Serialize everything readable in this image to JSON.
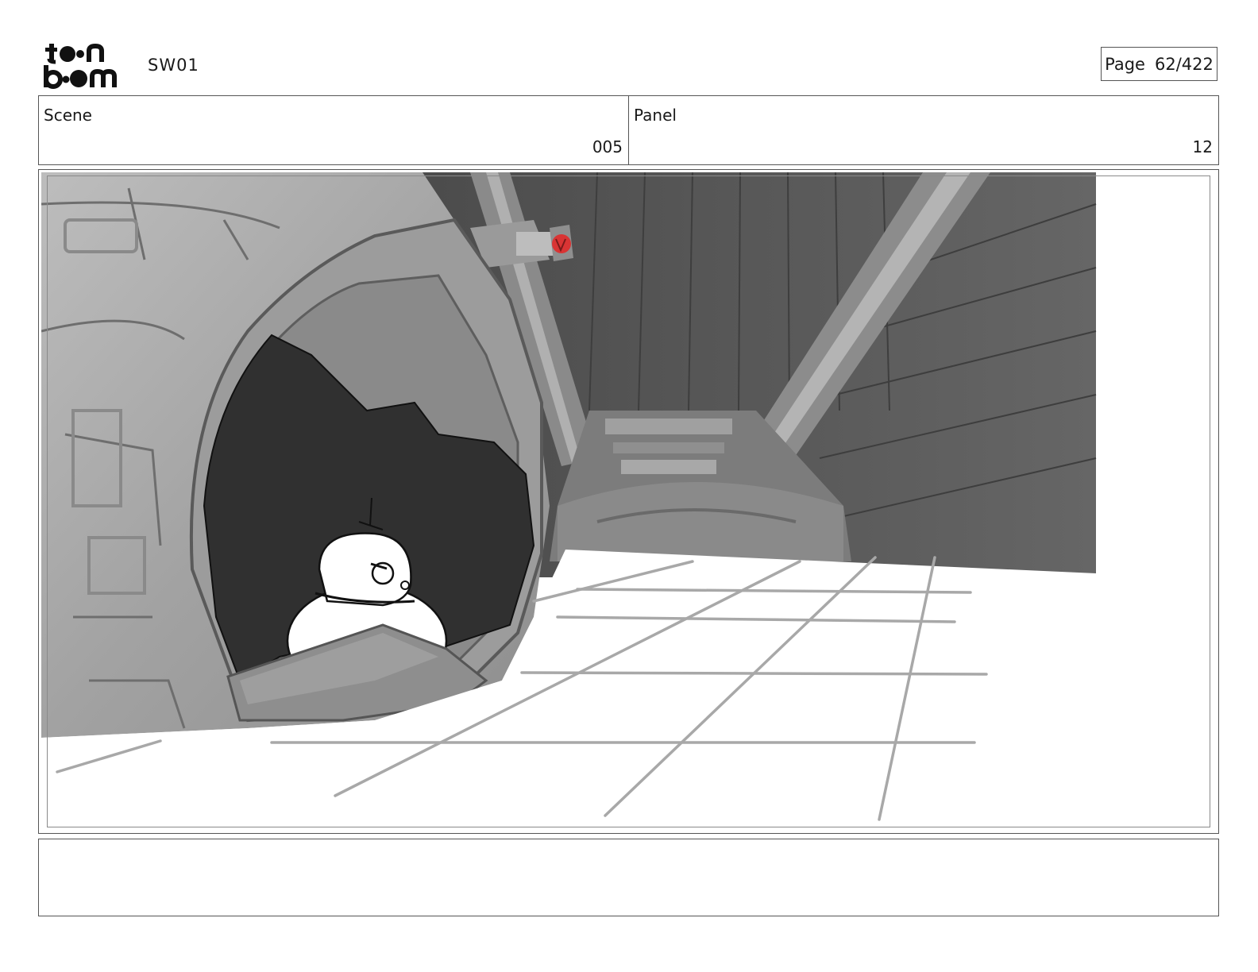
{
  "header": {
    "logo_text": "toon boom",
    "project": "SW01",
    "page_label": "Page",
    "page_value": "62/422"
  },
  "info": {
    "scene_label": "Scene",
    "scene_value": "005",
    "panel_label": "Panel",
    "panel_value": "12"
  },
  "panel": {
    "image_description": "Storyboard panel: rounded droid peeking from a circular hatch of a grey spaceship, white tiled floor in foreground"
  },
  "notes": {
    "text": ""
  }
}
